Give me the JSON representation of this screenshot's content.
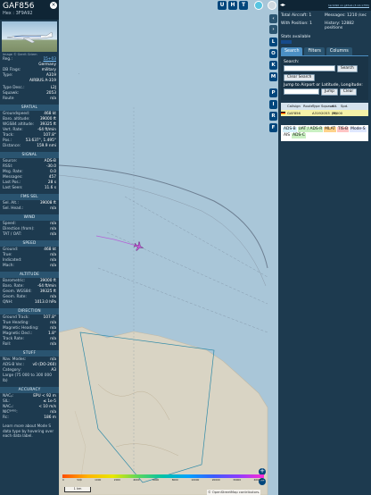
{
  "info": {
    "callsign": "GAF856",
    "hex_line": "Hex : 3F9A92",
    "close_label": "×",
    "photo_credit": "Image © Gerrit Griem",
    "reg_label": "Reg.:",
    "reg_value": "15+03",
    "country_value": "Germany",
    "db_flags_label": "DB Flags:",
    "db_flags_value": "military",
    "type_label": "Type:",
    "type_value": "A319",
    "model_value": "AIRBUS A-319",
    "type_desc_label": "Type Desc.:",
    "type_desc_value": "L2J",
    "squawk_label": "Squawk:",
    "squawk_value": "2053",
    "route_label": "Route",
    "route_value": "n/a",
    "sec_spatial": "SPATIAL",
    "spatial": [
      {
        "k": "Groundspeed:",
        "v": "468 kt"
      },
      {
        "k": "Baro. altitude:",
        "v": "39000 ft"
      },
      {
        "k": "WGS84 altitude:",
        "v": "39325 ft"
      },
      {
        "k": "Vert. Rate:",
        "v": "-64 ft/min"
      },
      {
        "k": "Track:",
        "v": "107.8°"
      },
      {
        "k": "Pos.:",
        "v": "53.637°, 1.495°"
      },
      {
        "k": "Distance:",
        "v": "159.9 nmi"
      }
    ],
    "sec_signal": "SIGNAL",
    "signal": [
      {
        "k": "Source:",
        "v": "ADS-B"
      },
      {
        "k": "RSSI:",
        "v": "-30.0"
      },
      {
        "k": "Msg. Rate:",
        "v": "0.0"
      },
      {
        "k": "Messages:",
        "v": "457"
      },
      {
        "k": "Last Pos.:",
        "v": "28 s"
      },
      {
        "k": "Last Seen:",
        "v": "11.6 s"
      }
    ],
    "sec_fms": "FMS SEL",
    "fms": [
      {
        "k": "Sel. Alt.:",
        "v": "39008 ft"
      },
      {
        "k": "Sel. Head.:",
        "v": "n/a"
      }
    ],
    "sec_wind": "WIND",
    "wind": [
      {
        "k": "Speed:",
        "v": "n/a"
      },
      {
        "k": "Direction (from):",
        "v": "n/a"
      },
      {
        "k": "TAT / OAT:",
        "v": "n/a"
      }
    ],
    "sec_speed": "SPEED",
    "speed": [
      {
        "k": "Ground:",
        "v": "468 kt"
      },
      {
        "k": "True:",
        "v": "n/a"
      },
      {
        "k": "Indicated:",
        "v": "n/a"
      },
      {
        "k": "Mach:",
        "v": "n/a"
      }
    ],
    "sec_altitude": "ALTITUDE",
    "altitude": [
      {
        "k": "Barometric:",
        "v": "39000 ft"
      },
      {
        "k": "Baro. Rate:",
        "v": "-64 ft/min"
      },
      {
        "k": "Geom. WGS84:",
        "v": "39325 ft"
      },
      {
        "k": "Geom. Rate:",
        "v": "n/a"
      },
      {
        "k": "QNH:",
        "v": "1013.0 hPa"
      }
    ],
    "sec_direction": "DIRECTION",
    "direction": [
      {
        "k": "Ground Track:",
        "v": "107.8°"
      },
      {
        "k": "True Heading:",
        "v": "n/a"
      },
      {
        "k": "Magnetic Heading:",
        "v": "n/a"
      },
      {
        "k": "Magnetic Decl.:",
        "v": "1.8°"
      },
      {
        "k": "Track Rate:",
        "v": "n/a"
      },
      {
        "k": "Roll:",
        "v": "n/a"
      }
    ],
    "sec_stuff": "STUFF",
    "stuff": [
      {
        "k": "Nav. Modes:",
        "v": "n/a"
      },
      {
        "k": "ADS-B Ver.:",
        "v": "v0 (DO-260)"
      },
      {
        "k": "Category:",
        "v": "A3"
      }
    ],
    "category_desc": "Large (75 000 to 300 000 lb)",
    "sec_accuracy": "ACCURACY",
    "accuracy": [
      {
        "k": "NACₚ:",
        "v": "EPU < 92 m"
      },
      {
        "k": "SIL:",
        "v": "≤ 1e-5"
      },
      {
        "k": "NACᵥ:",
        "v": "< 10 m/s"
      },
      {
        "k": "NICᴮᴬᴿᴼ:",
        "v": "n/a"
      },
      {
        "k": "Rc:",
        "v": "186 m"
      }
    ],
    "note": "Learn more about Mode S data type by hovering over each data label."
  },
  "top_buttons": [
    "U",
    "H",
    "T"
  ],
  "vertical_buttons": [
    "L",
    "O",
    "K",
    "M",
    "P",
    "I",
    "R",
    "F"
  ],
  "sidebar": {
    "arrows": "◂▸",
    "version": "tar1090 on github (3.14.1755)",
    "total_aircraft": "Total Aircraft: 1",
    "with_position": "With Position: 1",
    "messages": "Messages: 1210 /sec",
    "history": "History: 12882 positions",
    "stats_unavailable": "Stats available",
    "tabs": [
      "Search",
      "Filters",
      "Columns"
    ],
    "search_label": "Search:",
    "search_button": "Search",
    "clear_search_button": "Clear Search",
    "jump_label": "Jump to Airport or Latitude, Longitude:",
    "jump_button": "Jump",
    "clear_button": "Clear",
    "table_headers": [
      "",
      "Callsign",
      "Route",
      "Type",
      "Squawk",
      "Alt. (ft)",
      "Spd.",
      ""
    ],
    "table_rows": [
      {
        "callsign": "GAF856",
        "route": "",
        "type": "A319",
        "squawk": "2053",
        "alt": "39000",
        "spd": ""
      }
    ],
    "legend": [
      {
        "label": "ADS-B",
        "color": "#d7f3ff"
      },
      {
        "label": "UAT / ADS-R",
        "color": "#c9f0c2"
      },
      {
        "label": "MLAT",
        "color": "#ffd28a"
      },
      {
        "label": "TIS-B",
        "color": "#ffc4c4"
      },
      {
        "label": "Mode-S",
        "color": "#dfe7ff"
      },
      {
        "label": "AIS",
        "color": "#ffffff"
      },
      {
        "label": "ADS-C",
        "color": "#c9f0c2"
      }
    ]
  },
  "map": {
    "scale_label": "1 km",
    "attribution": "© OpenStreetMap contributors.",
    "alt_ticks": [
      "0",
      "500",
      "1000",
      "2000",
      "4000",
      "6000",
      "8000",
      "10000",
      "20000",
      "30000",
      "40000+"
    ],
    "zoom_in": "+",
    "zoom_out": "−"
  },
  "colors": {
    "panel": "#1d3a4f",
    "header": "#0f2535",
    "button": "#00467c",
    "sea": "#a9c6d8",
    "land": "#d9d4c4",
    "selected_row": "#f6f2a8",
    "aircraft": "#c45bd6"
  }
}
